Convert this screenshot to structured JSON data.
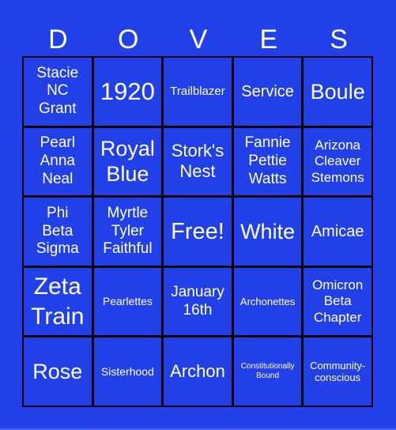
{
  "title_letters": [
    "D",
    "O",
    "V",
    "E",
    "S"
  ],
  "cells": [
    [
      "Stacie\nNC\nGrant",
      "1920",
      "Trailblazer",
      "Service",
      "Boule"
    ],
    [
      "Pearl\nAnna\nNeal",
      "Royal\nBlue",
      "Stork's\nNest",
      "Fannie\nPettie\nWatts",
      "Arizona\nCleaver\nStemons"
    ],
    [
      "Phi\nBeta\nSigma",
      "Myrtle\nTyler\nFaithful",
      "Free!",
      "White",
      "Amicae"
    ],
    [
      "Zeta\nTrain",
      "Pearlettes",
      "January\n16th",
      "Archonettes",
      "Omicron\nBeta\nChapter"
    ],
    [
      "Rose",
      "Sisterhood",
      "Archon",
      "Constitutionally\nBound",
      "Community-\nconscious"
    ]
  ],
  "colors": {
    "background": "#2240e8",
    "grid_lines": "#000000",
    "text": "#ffffff"
  }
}
